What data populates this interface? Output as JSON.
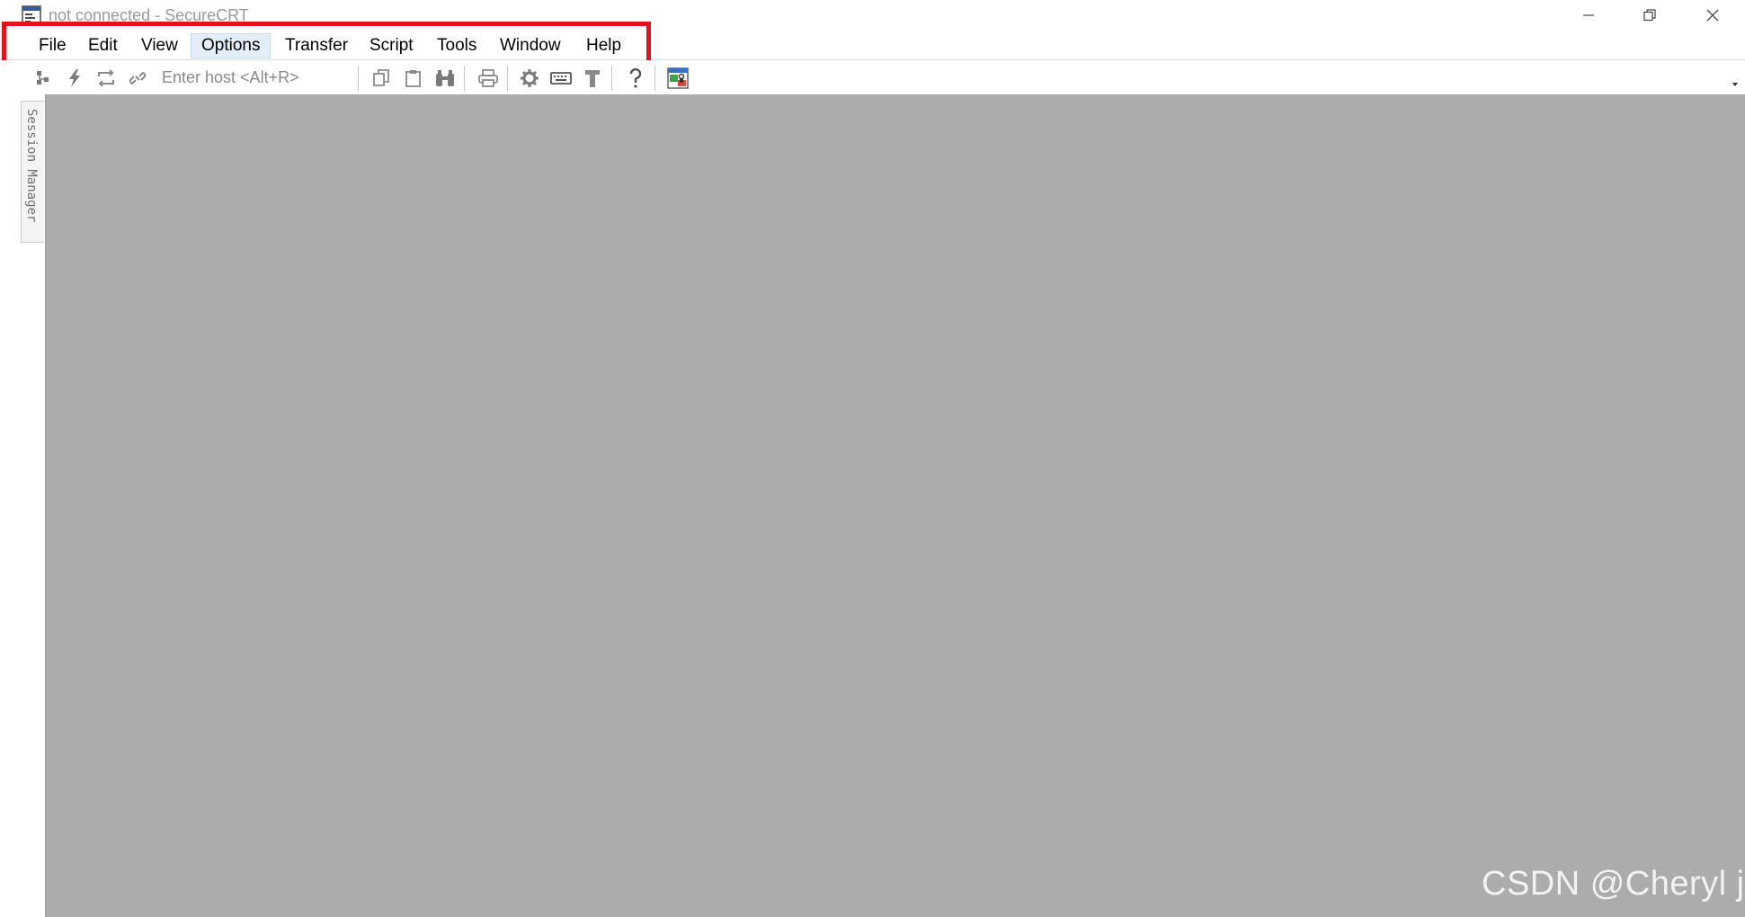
{
  "window": {
    "title": "not connected - SecureCRT",
    "icon": "securecrt-app-icon"
  },
  "menubar": {
    "items": [
      {
        "label": "File"
      },
      {
        "label": "Edit"
      },
      {
        "label": "View"
      },
      {
        "label": "Options",
        "state": "hovered"
      },
      {
        "label": "Transfer"
      },
      {
        "label": "Script"
      },
      {
        "label": "Tools"
      },
      {
        "label": "Window"
      },
      {
        "label": "Help"
      }
    ],
    "highlight_color": "#e0141c"
  },
  "toolbar": {
    "host_placeholder": "Enter host <Alt+R>",
    "icons": [
      "connect-icon",
      "quick-connect-icon",
      "reconnect-icon",
      "disconnect-icon",
      "copy-icon",
      "paste-icon",
      "find-icon",
      "print-icon",
      "settings-icon",
      "keymap-icon",
      "sftp-icon",
      "help-icon",
      "keygen-icon"
    ]
  },
  "sidebar": {
    "session_manager_label": "Session Manager"
  },
  "workarea": {
    "background": "#acacac"
  },
  "watermark": {
    "text": "CSDN @Cheryl jin"
  }
}
